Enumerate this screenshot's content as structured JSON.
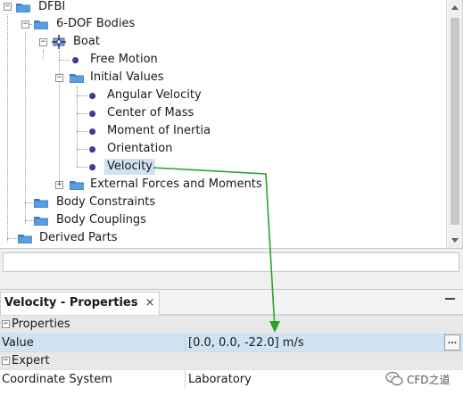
{
  "tree": {
    "items": [
      {
        "label": "DFBI"
      },
      {
        "label": "6-DOF Bodies"
      },
      {
        "label": "Boat"
      },
      {
        "label": "Free Motion"
      },
      {
        "label": "Initial Values"
      },
      {
        "label": "Angular Velocity"
      },
      {
        "label": "Center of Mass"
      },
      {
        "label": "Moment of Inertia"
      },
      {
        "label": "Orientation"
      },
      {
        "label": "Velocity"
      },
      {
        "label": "External Forces and Moments"
      },
      {
        "label": "Body Constraints"
      },
      {
        "label": "Body Couplings"
      },
      {
        "label": "Derived Parts"
      }
    ],
    "selected": "Velocity"
  },
  "properties_panel": {
    "tab_title": "Velocity - Properties",
    "close_glyph": "×",
    "sections": [
      {
        "title": "Properties",
        "collapse_glyph": "⊟",
        "rows": [
          {
            "name": "Value",
            "value": "[0.0, 0.0, -22.0] m/s",
            "button": "..."
          }
        ]
      },
      {
        "title": "Expert",
        "collapse_glyph": "⊟",
        "rows": [
          {
            "name": "Coordinate System",
            "value": "Laboratory"
          }
        ]
      }
    ]
  },
  "icons": {
    "folder": "folder-icon",
    "leaf": "blue-dot-icon",
    "boat": "body-crosshair-icon",
    "expand": "plus-square-icon",
    "collapse": "minus-square-icon"
  },
  "colors": {
    "selection": "#cfe3f3",
    "arrow": "#2ca02c",
    "folder": "#3a7fc6",
    "dot": "#3c3fa8"
  },
  "watermark": {
    "text": "CFD之道"
  }
}
